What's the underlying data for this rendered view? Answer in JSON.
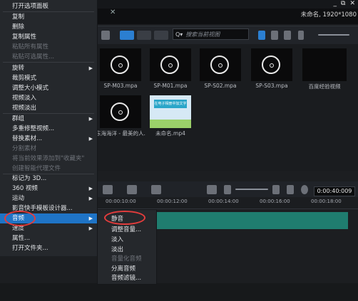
{
  "window": {
    "project_info": "未命名, 1920*1080",
    "win_controls": [
      "_",
      "⧉",
      "✕"
    ]
  },
  "search": {
    "placeholder": "搜索当前视图"
  },
  "media": {
    "items": [
      {
        "name": "SP-M03.mpa"
      },
      {
        "name": "SP-M01.mpa"
      },
      {
        "name": "SP-S02.mpa"
      },
      {
        "name": "SP-S03.mpa"
      },
      {
        "name": "百度经验视频"
      },
      {
        "name": "东海海洋 - 最美的人..."
      },
      {
        "name": "未命名.mp4"
      }
    ],
    "thumb_caption": "在电子相册中加文字"
  },
  "timeline": {
    "timecode": "0:00:40:009",
    "ruler": [
      "00:00:10:00",
      "00:00:12:00",
      "00:00:14:00",
      "00:00:16:00",
      "00:00:18:00"
    ]
  },
  "context_menu": {
    "items": [
      {
        "label": "打开选项面板",
        "state": "normal"
      },
      {
        "label": "复制",
        "state": "normal"
      },
      {
        "label": "删除",
        "state": "normal"
      },
      {
        "label": "复制属性",
        "state": "normal"
      },
      {
        "label": "粘贴所有属性",
        "state": "disabled"
      },
      {
        "label": "粘贴可选属性...",
        "state": "disabled"
      },
      {
        "label": "旋转",
        "state": "normal",
        "submenu": true
      },
      {
        "label": "裁剪模式",
        "state": "normal"
      },
      {
        "label": "调整大小模式",
        "state": "normal"
      },
      {
        "label": "视频淡入",
        "state": "normal"
      },
      {
        "label": "视频淡出",
        "state": "normal"
      },
      {
        "label": "群组",
        "state": "normal",
        "submenu": true
      },
      {
        "label": "多重修整视频...",
        "state": "normal"
      },
      {
        "label": "替换素材...",
        "state": "normal",
        "submenu": true
      },
      {
        "label": "分割素材",
        "state": "disabled"
      },
      {
        "label": "将当前效果添加到\"收藏夹\"",
        "state": "disabled"
      },
      {
        "label": "创建智能代理文件",
        "state": "disabled"
      },
      {
        "label": "标记为 3D...",
        "state": "normal"
      },
      {
        "label": "360 视频",
        "state": "normal",
        "submenu": true
      },
      {
        "label": "运动",
        "state": "normal",
        "submenu": true
      },
      {
        "label": "影音快手模板设计器...",
        "state": "normal"
      },
      {
        "label": "音频",
        "state": "selected",
        "submenu": true
      },
      {
        "label": "速度",
        "state": "normal",
        "submenu": true
      },
      {
        "label": "属性...",
        "state": "normal"
      },
      {
        "label": "打开文件夹...",
        "state": "normal"
      }
    ]
  },
  "audio_submenu": {
    "items": [
      {
        "label": "静音",
        "state": "normal"
      },
      {
        "label": "调整音量...",
        "state": "normal"
      },
      {
        "label": "淡入",
        "state": "normal"
      },
      {
        "label": "淡出",
        "state": "normal"
      },
      {
        "label": "音量化音频",
        "state": "disabled"
      },
      {
        "label": "分离音频",
        "state": "normal"
      },
      {
        "label": "音频滤镜...",
        "state": "normal"
      }
    ]
  },
  "colors": {
    "accent": "#1f74c6",
    "track": "#1f7d6f",
    "highlight_ring": "#e23c3c"
  }
}
